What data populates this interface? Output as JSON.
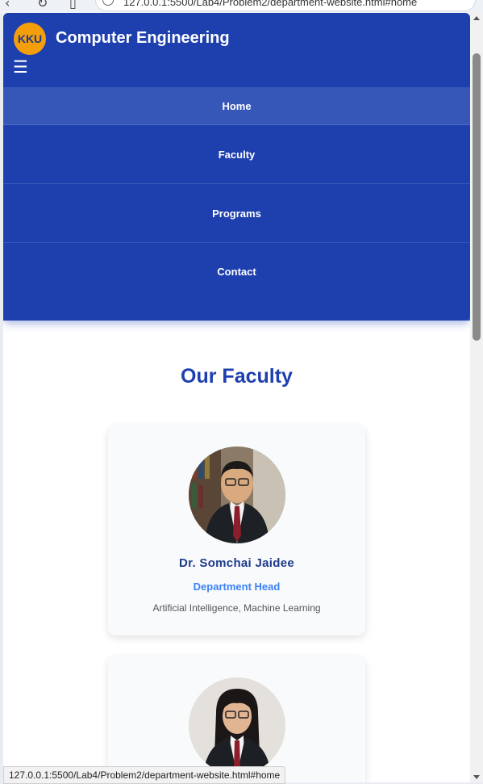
{
  "browser": {
    "url_fragment": "127.0.0.1:5500/Lab4/Problem2/department-website.html#home"
  },
  "header": {
    "logo_text": "KKU",
    "site_title": "Computer Engineering",
    "menu_toggle_icon": "hamburger-icon",
    "menu_toggle_glyph": "☰"
  },
  "nav": {
    "items": [
      {
        "label": "Home",
        "active": true
      },
      {
        "label": "Faculty"
      },
      {
        "label": "Programs"
      },
      {
        "label": "Contact"
      }
    ]
  },
  "faculty": {
    "title": "Our Faculty",
    "members": [
      {
        "name": "Dr. Somchai Jaidee",
        "role": "Department Head",
        "specialty": "Artificial Intelligence, Machine Learning"
      },
      {}
    ]
  },
  "status_bar": {
    "link_preview": "127.0.0.1:5500/Lab4/Problem2/department-website.html#home"
  },
  "colors": {
    "primary": "#1e40af",
    "accent": "#f59e0b",
    "role_text": "#3b82f6"
  }
}
